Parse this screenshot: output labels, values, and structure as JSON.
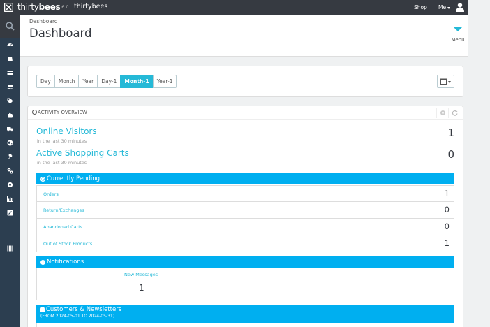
{
  "topbar": {
    "brand_light": "thirty",
    "brand_bold": "bees",
    "version": "1.6.0",
    "shop_name": "thirtybees",
    "shop_link": "Shop",
    "me_link": "Me"
  },
  "sidebar": {
    "items": [
      {
        "icon": "dashboard-icon"
      },
      {
        "icon": "catalog-icon"
      },
      {
        "icon": "orders-icon"
      },
      {
        "icon": "customers-icon"
      },
      {
        "icon": "price-rules-icon"
      },
      {
        "icon": "modules-icon"
      },
      {
        "icon": "shipping-icon"
      },
      {
        "icon": "localization-icon"
      },
      {
        "icon": "preferences-icon"
      },
      {
        "icon": "advanced-parameters-icon"
      },
      {
        "icon": "administration-icon"
      },
      {
        "icon": "stats-icon"
      },
      {
        "icon": "notes-icon"
      },
      {
        "icon": "collapse-icon"
      }
    ]
  },
  "header": {
    "breadcrumb": "Dashboard",
    "title": "Dashboard",
    "menu_label": "Menu"
  },
  "period": {
    "buttons": [
      "Day",
      "Month",
      "Year",
      "Day-1",
      "Month-1",
      "Year-1"
    ],
    "active": "Month-1"
  },
  "activity": {
    "title": "Activity overview",
    "online_visitors": {
      "label": "Online Visitors",
      "sub": "in the last 30 minutes",
      "value": "1"
    },
    "active_carts": {
      "label": "Active Shopping Carts",
      "sub": "in the last 30 minutes",
      "value": "0"
    },
    "pending": {
      "title": "Currently Pending",
      "rows": [
        {
          "label": "Orders",
          "value": "1"
        },
        {
          "label": "Return/Exchanges",
          "value": "0"
        },
        {
          "label": "Abandoned Carts",
          "value": "0"
        },
        {
          "label": "Out of Stock Products",
          "value": "1"
        }
      ]
    },
    "notifications": {
      "title": "Notifications",
      "label": "New Messages",
      "value": "1"
    },
    "customers": {
      "title": "Customers & Newsletters",
      "range": "(FROM 2024-05-01 TO 2024-05-31)"
    }
  },
  "colors": {
    "accent": "#25b9d7",
    "section": "#00aff0",
    "sidebar": "#2c3e50",
    "topbar": "#363a41"
  }
}
